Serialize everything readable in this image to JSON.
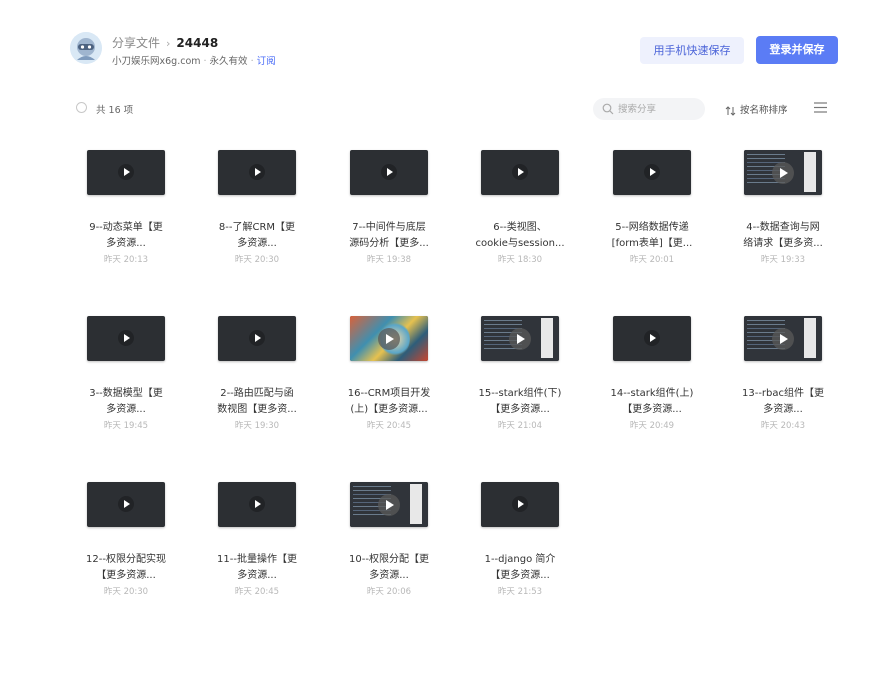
{
  "header": {
    "crumb": "分享文件",
    "separator": "›",
    "share_id": "24448",
    "owner": "小刀娱乐网x6g.com",
    "validity": "永久有效",
    "subscribe_label": "订阅",
    "btn_phone_save": "用手机快速保存",
    "btn_login_save": "登录并保存"
  },
  "toolbar": {
    "count_label": "共 16 项",
    "search_placeholder": "搜索分享",
    "sort_label": "按名称排序"
  },
  "files": [
    {
      "line1": "9--动态菜单【更",
      "line2": "多资源...",
      "time": "昨天 20:13",
      "thumb": "video"
    },
    {
      "line1": "8--了解CRM【更",
      "line2": "多资源...",
      "time": "昨天 20:30",
      "thumb": "video"
    },
    {
      "line1": "7--中间件与底层",
      "line2": "源码分析【更多...",
      "time": "昨天 19:38",
      "thumb": "video"
    },
    {
      "line1": "6--类视图、",
      "line2": "cookie与session...",
      "time": "昨天 18:30",
      "thumb": "video"
    },
    {
      "line1": "5--网络数据传递",
      "line2": "[form表单]【更...",
      "time": "昨天 20:01",
      "thumb": "video"
    },
    {
      "line1": "4--数据查询与网",
      "line2": "络请求【更多资...",
      "time": "昨天 19:33",
      "thumb": "screen"
    },
    {
      "line1": "3--数据模型【更",
      "line2": "多资源...",
      "time": "昨天 19:45",
      "thumb": "video"
    },
    {
      "line1": "2--路由匹配与函",
      "line2": "数视图【更多资...",
      "time": "昨天 19:30",
      "thumb": "video"
    },
    {
      "line1": "16--CRM项目开发",
      "line2": "(上)【更多资源...",
      "time": "昨天 20:45",
      "thumb": "art"
    },
    {
      "line1": "15--stark组件(下)",
      "line2": "【更多资源...",
      "time": "昨天 21:04",
      "thumb": "screen"
    },
    {
      "line1": "14--stark组件(上)",
      "line2": "【更多资源...",
      "time": "昨天 20:49",
      "thumb": "video"
    },
    {
      "line1": "13--rbac组件【更",
      "line2": "多资源...",
      "time": "昨天 20:43",
      "thumb": "screen"
    },
    {
      "line1": "12--权限分配实现",
      "line2": "【更多资源...",
      "time": "昨天 20:30",
      "thumb": "video"
    },
    {
      "line1": "11--批量操作【更",
      "line2": "多资源...",
      "time": "昨天 20:45",
      "thumb": "video"
    },
    {
      "line1": "10--权限分配【更",
      "line2": "多资源...",
      "time": "昨天 20:06",
      "thumb": "screen"
    },
    {
      "line1": "1--django 简介",
      "line2": "【更多资源...",
      "time": "昨天 21:53",
      "thumb": "video"
    }
  ],
  "icons": {
    "avatar": "user-avatar-icon",
    "search": "search-icon",
    "sort": "sort-arrows-icon",
    "list": "list-view-icon",
    "play": "play-icon"
  },
  "colors": {
    "accent": "#5b7cf5",
    "accent_light": "#eef1fd",
    "link": "#4a6cf7"
  }
}
